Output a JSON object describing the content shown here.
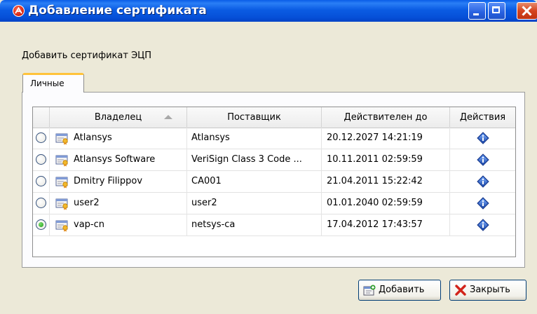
{
  "window": {
    "title": "Добавление сертификата",
    "subtitle": "Добавить сертификат ЭЦП",
    "colors": {
      "titlebar": "#0b5ce3",
      "body": "#ece9d8",
      "tab_accent": "#ffc33b",
      "close_button": "#d5441f"
    }
  },
  "tabs": [
    {
      "label": "Личные",
      "active": true
    }
  ],
  "table": {
    "columns": [
      "Владелец",
      "Поставщик",
      "Действителен до",
      "Действия"
    ],
    "sort_column": "Владелец",
    "rows": [
      {
        "selected": false,
        "owner": "Atlansys",
        "issuer": "Atlansys",
        "valid_until": "20.12.2027 14:21:19",
        "action_icon": "info-icon"
      },
      {
        "selected": false,
        "owner": "Atlansys Software",
        "issuer": "VeriSign Class 3 Code ...",
        "valid_until": "10.11.2011 02:59:59",
        "action_icon": "info-icon"
      },
      {
        "selected": false,
        "owner": "Dmitry Filippov",
        "issuer": "CA001",
        "valid_until": "21.04.2011 15:22:42",
        "action_icon": "info-icon"
      },
      {
        "selected": false,
        "owner": "user2",
        "issuer": "user2",
        "valid_until": "01.01.2040 02:59:59",
        "action_icon": "info-icon"
      },
      {
        "selected": true,
        "owner": "vap-cn",
        "issuer": "netsys-ca",
        "valid_until": "17.04.2012 17:43:57",
        "action_icon": "info-icon"
      }
    ]
  },
  "buttons": {
    "add_label": "Добавить",
    "close_label": "Закрыть"
  }
}
